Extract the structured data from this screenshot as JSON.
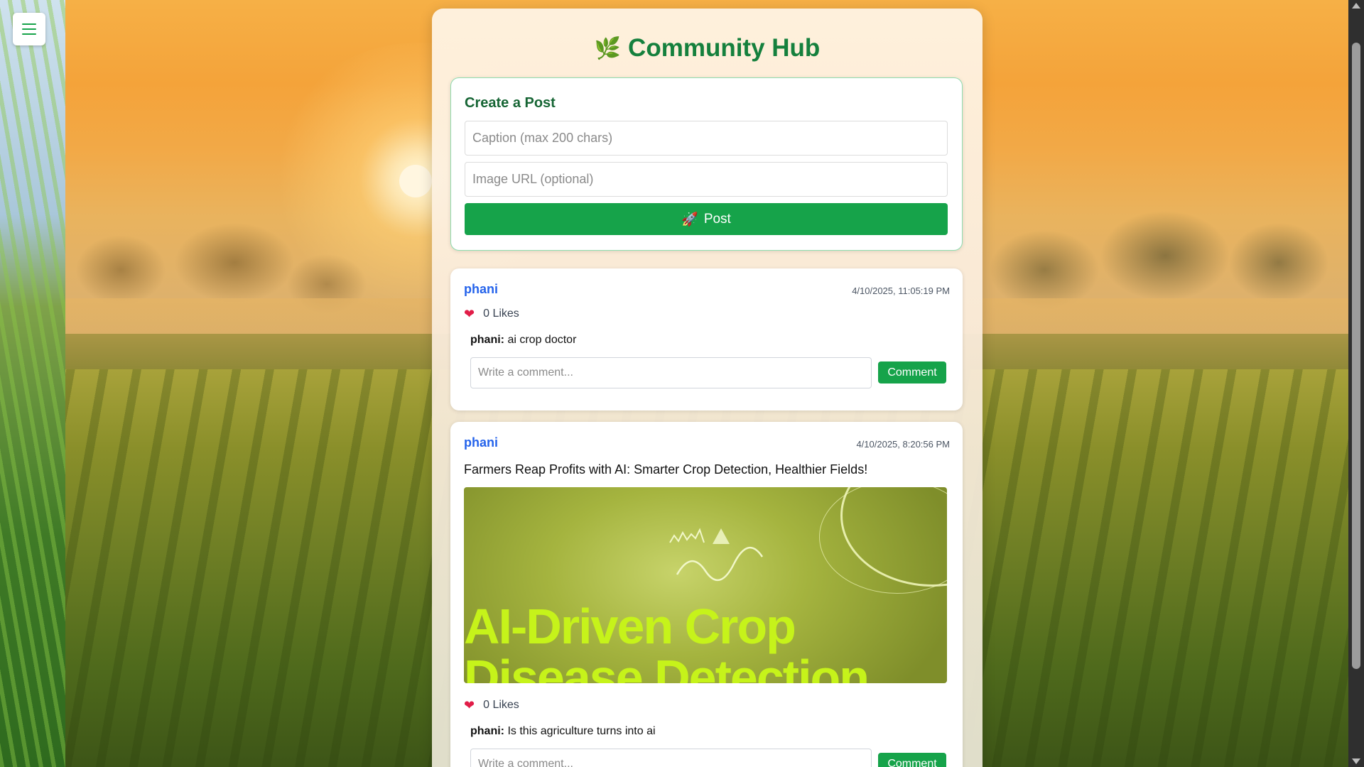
{
  "app": {
    "title": "Community Hub",
    "leaf_icon": "leaf-icon"
  },
  "colors": {
    "accent": "#16a34a",
    "title": "#15803d",
    "author": "#2563eb",
    "heart": "#e11d48"
  },
  "create_post": {
    "heading": "Create a Post",
    "caption_placeholder": "Caption (max 200 chars)",
    "image_placeholder": "Image URL (optional)",
    "post_label": "Post",
    "post_icon": "rocket-icon"
  },
  "posts": [
    {
      "author": "phani",
      "timestamp": "4/10/2025, 11:05:19 PM",
      "caption": "",
      "likes": "0 Likes",
      "comments": [
        {
          "author": "phani:",
          "text": "ai crop doctor"
        }
      ],
      "comment_placeholder": "Write a comment...",
      "comment_button": "Comment"
    },
    {
      "author": "phani",
      "timestamp": "4/10/2025, 8:20:56 PM",
      "caption": "Farmers Reap Profits with AI: Smarter Crop Detection, Healthier Fields!",
      "image_text": "AI-Driven Crop",
      "image_text_2": "Disease Detection",
      "likes": "0 Likes",
      "comments": [
        {
          "author": "phani:",
          "text": "Is this agriculture turns into ai"
        }
      ],
      "comment_placeholder": "Write a comment...",
      "comment_button": "Comment"
    }
  ]
}
